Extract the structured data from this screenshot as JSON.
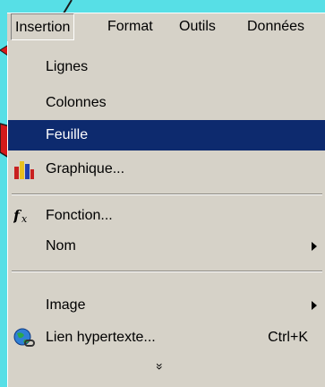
{
  "menubar": {
    "items": [
      "Insertion",
      "Format",
      "Outils",
      "Données"
    ]
  },
  "menu": {
    "items": [
      {
        "label": "Lignes"
      },
      {
        "label": "Colonnes"
      },
      {
        "label": "Feuille"
      },
      {
        "label": "Graphique..."
      },
      {
        "label": "Fonction..."
      },
      {
        "label": "Nom"
      },
      {
        "label": "Image"
      },
      {
        "label": "Lien hypertexte...",
        "shortcut": "Ctrl+K"
      }
    ],
    "more_glyph": "»"
  },
  "colors": {
    "background": "#57dfe6",
    "menu": "#d6d2c8",
    "highlight": "#0d2a6e",
    "annotation_arrow": "#d41a1a"
  },
  "icons": [
    "chart-icon",
    "function-icon",
    "hyperlink-globe-icon",
    "submenu-arrow-icon",
    "expand-chevron-icon"
  ]
}
